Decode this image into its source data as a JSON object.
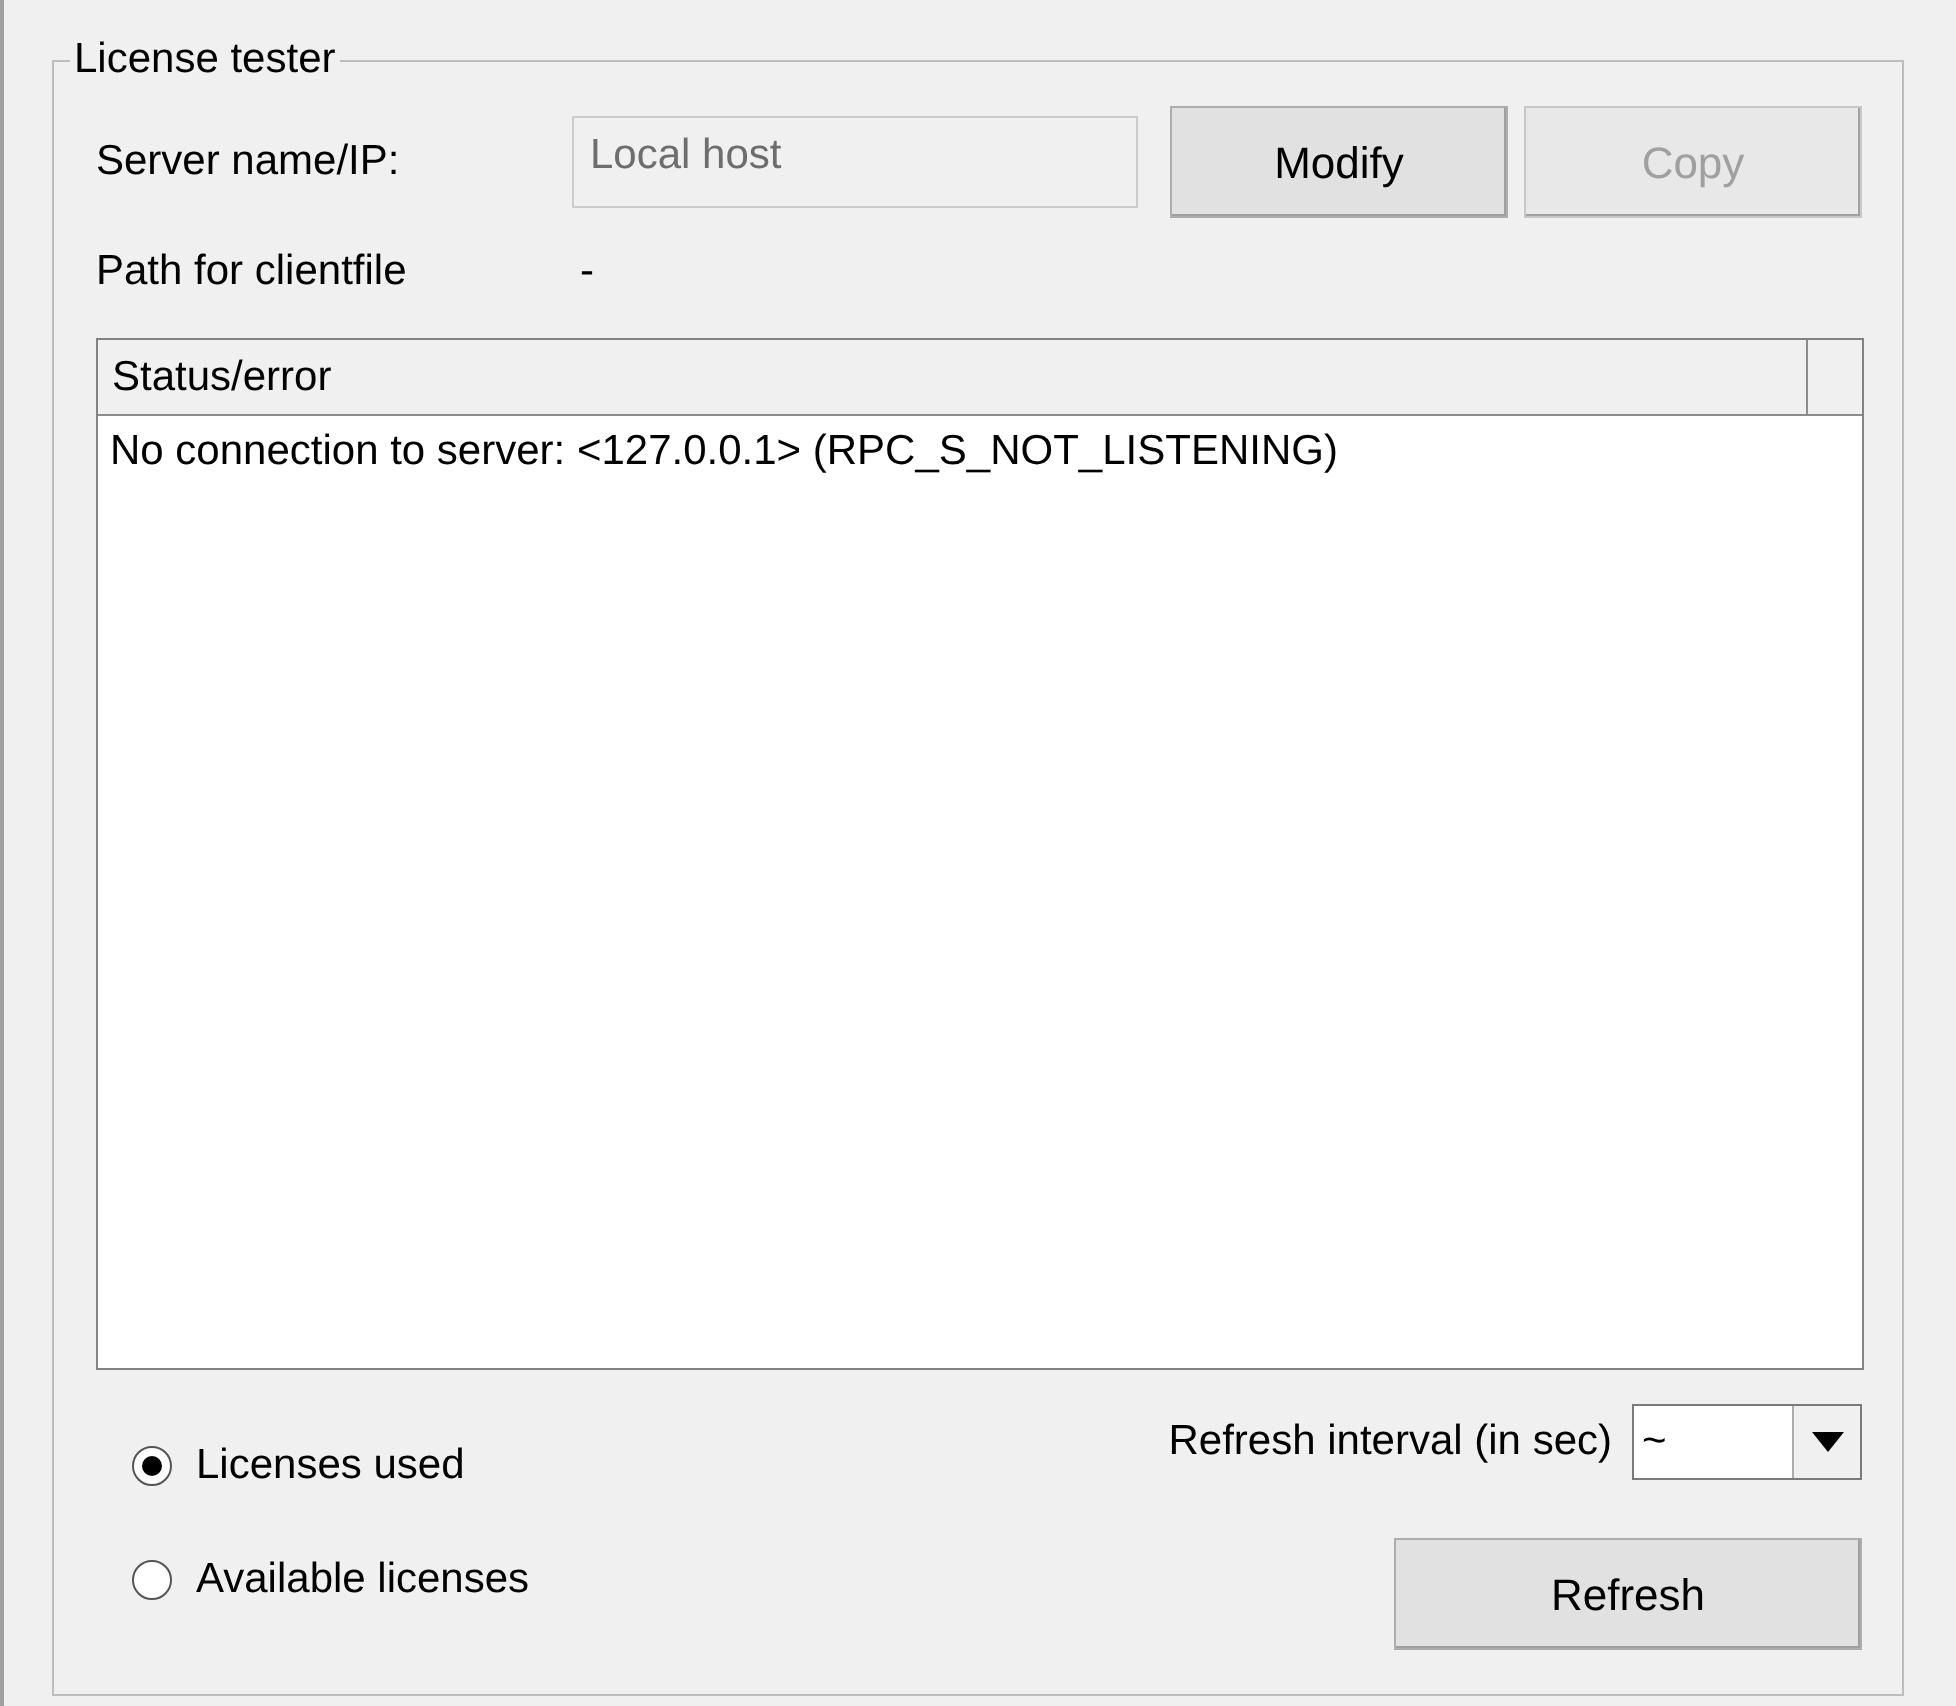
{
  "group": {
    "title": "License tester"
  },
  "server": {
    "label": "Server name/IP:",
    "placeholder": "Local host",
    "disabled": true
  },
  "buttons": [
    {
      "label": "Modify",
      "disabled": false
    },
    {
      "label": "Copy",
      "disabled": true
    }
  ],
  "path": {
    "label": "Path for clientfile",
    "value": "-"
  },
  "list": {
    "columns": [
      "Status/error"
    ],
    "rows": [
      "No connection to server: <127.0.0.1> (RPC_S_NOT_LISTENING)"
    ]
  },
  "radios": [
    {
      "label": "Licenses used",
      "selected": true
    },
    {
      "label": "Available licenses",
      "selected": false
    }
  ],
  "interval": {
    "label": "Refresh interval (in sec)",
    "value": "~"
  },
  "refresh": {
    "label": "Refresh"
  }
}
